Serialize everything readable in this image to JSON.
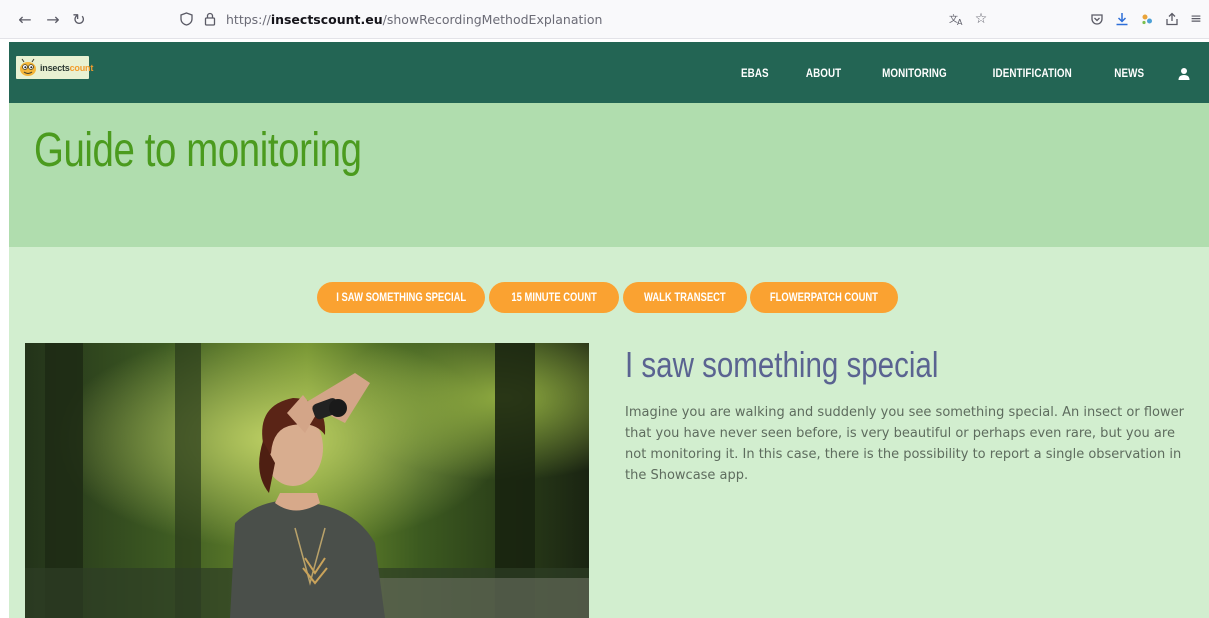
{
  "browser": {
    "url_prefix": "https://",
    "url_host": "insectscount.eu",
    "url_path": "/showRecordingMethodExplanation"
  },
  "site": {
    "logo_part1": "insects",
    "logo_part2": "count",
    "nav": [
      "EBAS",
      "ABOUT",
      "MONITORING",
      "IDENTIFICATION",
      "NEWS"
    ],
    "colors": {
      "nav_bg": "#236554",
      "hero_bg": "#b0ddae",
      "page_bg": "#d2eecf",
      "title_green": "#4b9b1e",
      "accent_orange": "#faa231",
      "heading_blue": "#5a6391"
    }
  },
  "hero": {
    "title": "Guide to monitoring"
  },
  "tabs": [
    "I SAW SOMETHING SPECIAL",
    "15 MINUTE COUNT",
    "WALK TRANSECT",
    "FLOWERPATCH COUNT"
  ],
  "content": {
    "title": "I saw something special",
    "body": "Imagine you are walking and suddenly you see something special. An insect or flower that you have never seen before, is very beautiful or perhaps even rare, but you are not monitoring it. In this case, there is the possibility to report a single observation in the Showcase app."
  },
  "icons": [
    "back-icon",
    "forward-icon",
    "reload-icon",
    "shield-icon",
    "lock-icon",
    "translate-icon",
    "bookmark-star-icon",
    "pocket-icon",
    "download-icon",
    "extension-icon",
    "share-icon",
    "menu-icon",
    "user-icon"
  ]
}
